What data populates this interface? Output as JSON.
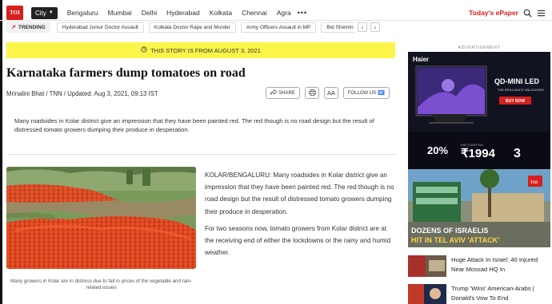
{
  "nav": {
    "logo": "TOI",
    "city_label": "City",
    "cities": [
      "Bengaluru",
      "Mumbai",
      "Delhi",
      "Hyderabad",
      "Kolkata",
      "Chennai",
      "Agra"
    ],
    "more": "•••",
    "epaper": "Today's ePaper"
  },
  "trending": {
    "label": "TRENDING",
    "items": [
      "Hyderabad Junior Doctor Assault",
      "Kolkata Doctor Rape and Murder",
      "Army Officers Assault in MP",
      "Bid Shemin"
    ]
  },
  "banner": {
    "text": "THIS STORY IS FROM AUGUST 3, 2021"
  },
  "article": {
    "headline": "Karnataka farmers dump tomatoes on road",
    "byline": "Mrinalini Bhat / TNN / Updated: Aug 3, 2021, 09:13 IST",
    "summary": "Many roadsides in Kolar district give an impression that they have been painted red. The red though is no road design but the result of distressed tomato growers dumping their produce in desperation.",
    "caption": "Many growers in Kolar are in distress due to fall in prices of the vegetable and rain-related issues",
    "para1": "KOLAR/BENGALURU: Many roadsides in Kolar district give an impression that they have been painted red. The red though is no road design but the result of distressed tomato growers dumping their produce in desperation.",
    "para2": "For two seasons now, tomato growers from Kolar district are at the receiving end of either the lockdowns or the rainy and humid weather."
  },
  "tools": {
    "share": "SHARE",
    "aa": "AA",
    "follow": "FOLLOW US"
  },
  "sidebar": {
    "ad_label": "ADVERTISEMENT",
    "ad": {
      "brand": "Haier",
      "product": "QD-MINI LED",
      "tagline": "THE BRILLIANCE UNLEASHED",
      "cta": "BUY NOW",
      "percent": "20%",
      "price_label": "EMI STARTING",
      "price": "₹1994",
      "num": "3"
    },
    "overlay": {
      "line1": "DOZENS OF ISRAELIS",
      "line2": "HIT IN TEL AVIV 'ATTACK'",
      "logo": "TOI"
    },
    "news": [
      {
        "title": "Huge Attack In Israel: 40 Injured Near Mossad HQ In"
      },
      {
        "title": "Trump 'Wins' American-Arabs | Donald's Vow To End"
      }
    ]
  }
}
